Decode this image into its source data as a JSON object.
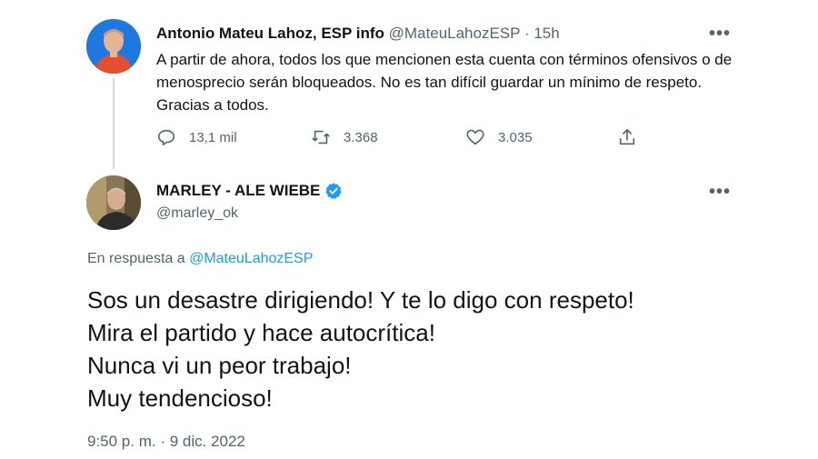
{
  "parent_tweet": {
    "display_name": "Antonio Mateu Lahoz, ESP info",
    "handle": "@MateuLahozESP",
    "separator": "·",
    "time_ago": "15h",
    "text": "A partir de ahora, todos los que mencionen esta cuenta con términos ofensivos o de menosprecio serán bloqueados. No es tan difícil guardar un mínimo de respeto. Gracias a todos.",
    "stats": {
      "replies": "13,1 mil",
      "retweets": "3.368",
      "likes": "3.035"
    },
    "more_label": "•••"
  },
  "reply_tweet": {
    "display_name": "MARLEY - ALE WIEBE",
    "handle": "@marley_ok",
    "more_label": "•••",
    "reply_prefix": "En respuesta a",
    "reply_mention": "@MateuLahozESP",
    "lines": [
      "Sos un desastre dirigiendo! Y te lo digo con respeto!",
      "Mira el partido y hace autocrítica!",
      "Nunca vi un peor trabajo!",
      "Muy tendencioso!"
    ],
    "timestamp": "9:50 p. m. · 9 dic. 2022"
  },
  "colors": {
    "text": "#0f1419",
    "secondary": "#536471",
    "accent": "#1d9bf0",
    "thread_line": "#cfd9de"
  },
  "icons": {
    "reply": "reply-icon",
    "retweet": "retweet-icon",
    "like": "heart-icon",
    "share": "share-icon",
    "verified": "verified-badge-icon"
  }
}
